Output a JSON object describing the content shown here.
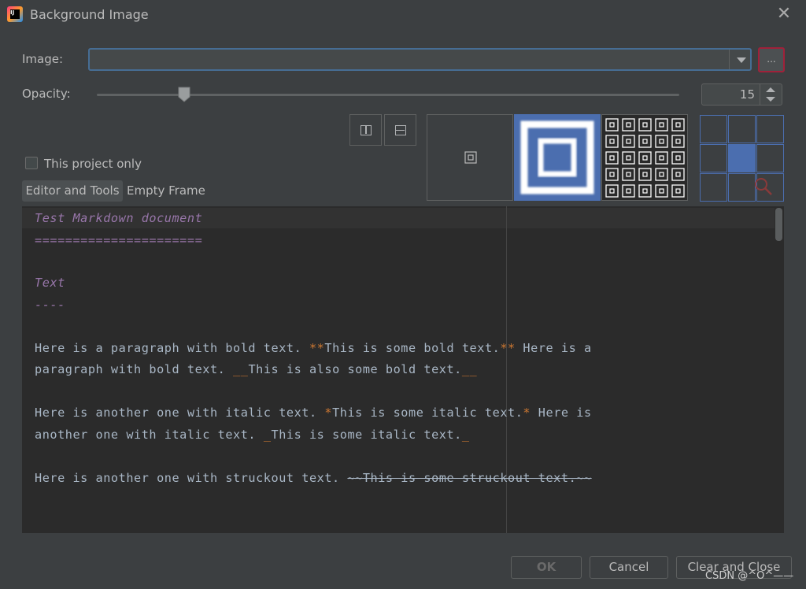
{
  "window": {
    "title": "Background Image",
    "close_glyph": "✕",
    "app_icon_text": "IJ"
  },
  "image": {
    "label": "Image:",
    "value": "",
    "browse_label": "..."
  },
  "opacity": {
    "label": "Opacity:",
    "value": "15",
    "level": 15
  },
  "options": {
    "this_project_only": "This project only",
    "checked": false
  },
  "tabs": [
    {
      "label": "Editor and Tools",
      "selected": true
    },
    {
      "label": "Empty Frame",
      "selected": false
    }
  ],
  "fill_modes": [
    "plain",
    "scale",
    "tile"
  ],
  "anchor": {
    "selected_cell": 4
  },
  "editor": {
    "lines": {
      "l1": "Test Markdown document",
      "l2": "======================",
      "l3": "Text",
      "l4": "----",
      "l5a": "Here is a paragraph with bold text. ",
      "l5b": "**",
      "l5c": "This is some bold text.",
      "l5d": "**",
      "l5e": " Here is a",
      "l6a": "paragraph with bold text. ",
      "l6b": "__",
      "l6c": "This is also some bold text.",
      "l6d": "__",
      "l7a": "Here is another one with italic text. ",
      "l7b": "*",
      "l7c": "This is some italic text.",
      "l7d": "*",
      "l7e": " Here is",
      "l8a": "another one with italic text. ",
      "l8b": "_",
      "l8c": "This is some italic text.",
      "l8d": "_",
      "l9a": "Here is another one with struckout text. ",
      "l9b": "~~This is some struckout text.~~"
    }
  },
  "buttons": {
    "ok": "OK",
    "cancel": "Cancel",
    "clear_and_close": "Clear and Close"
  },
  "watermark": "CSDN @^O^——",
  "colors": {
    "accent": "#4b6eaf",
    "focus_border": "#466d94",
    "browse_border": "#a0213a",
    "markup": "#cc7832",
    "heading": "#9876aa"
  }
}
